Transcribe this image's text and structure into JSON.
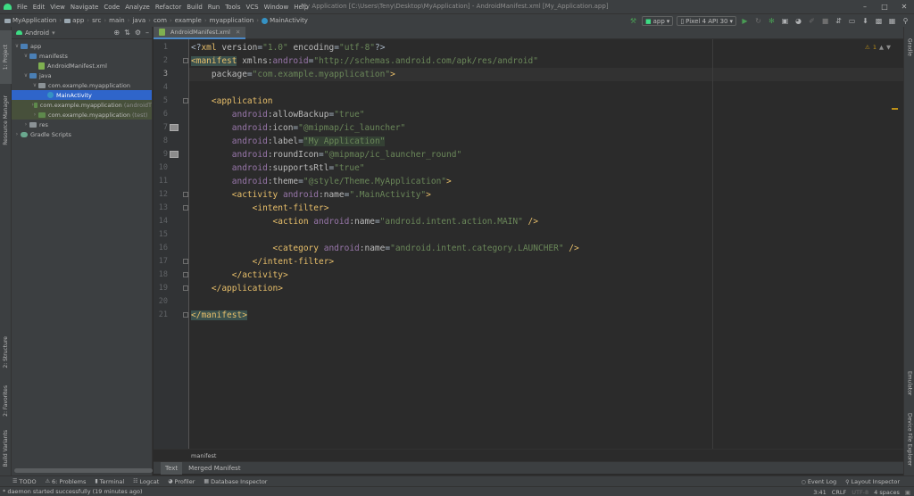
{
  "menubar": {
    "items": [
      "File",
      "Edit",
      "View",
      "Navigate",
      "Code",
      "Analyze",
      "Refactor",
      "Build",
      "Run",
      "Tools",
      "VCS",
      "Window",
      "Help"
    ],
    "window_title": "My Application [C:\\Users\\Teny\\Desktop\\MyApplication] - AndroidManifest.xml [My_Application.app]"
  },
  "navbar": {
    "breadcrumbs": [
      "MyApplication",
      "app",
      "src",
      "main",
      "java",
      "com",
      "example",
      "myapplication",
      "MainActivity"
    ],
    "run_config": "app",
    "device": "Pixel 4 API 30"
  },
  "left_tabs": [
    "1: Project",
    "Resource Manager",
    "2: Structure",
    "2: Favorites",
    "Build Variants"
  ],
  "right_tabs": [
    "Gradle",
    "Emulator",
    "Device File Explorer"
  ],
  "project": {
    "view_label": "Android",
    "tree": [
      {
        "label": "app",
        "suffix": "",
        "indent": 0,
        "arrow": "open",
        "icon": "folder-blue"
      },
      {
        "label": "manifests",
        "suffix": "",
        "indent": 1,
        "arrow": "open",
        "icon": "folder-blue"
      },
      {
        "label": "AndroidManifest.xml",
        "suffix": "",
        "indent": 2,
        "arrow": "",
        "icon": "xml"
      },
      {
        "label": "java",
        "suffix": "",
        "indent": 1,
        "arrow": "open",
        "icon": "folder-blue"
      },
      {
        "label": "com.example.myapplication",
        "suffix": "",
        "indent": 2,
        "arrow": "open",
        "icon": "folder-grey"
      },
      {
        "label": "MainActivity",
        "suffix": "",
        "indent": 3,
        "arrow": "",
        "icon": "class",
        "selected": true
      },
      {
        "label": "com.example.myapplication",
        "suffix": "(androidT",
        "indent": 2,
        "arrow": "closed",
        "icon": "folder-green",
        "green": true
      },
      {
        "label": "com.example.myapplication",
        "suffix": "(test)",
        "indent": 2,
        "arrow": "closed",
        "icon": "folder-green",
        "green": true
      },
      {
        "label": "res",
        "suffix": "",
        "indent": 1,
        "arrow": "closed",
        "icon": "folder-grey"
      },
      {
        "label": "Gradle Scripts",
        "suffix": "",
        "indent": 0,
        "arrow": "closed",
        "icon": "gradle"
      }
    ]
  },
  "editor": {
    "tab_label": "AndroidManifest.xml",
    "warning_count": "1",
    "breadcrumb": "manifest",
    "view_tabs": [
      "Text",
      "Merged Manifest"
    ],
    "lines": [
      [
        {
          "c": "p",
          "s": "<?"
        },
        {
          "c": "t",
          "s": "xml "
        },
        {
          "c": "a",
          "s": "version"
        },
        {
          "c": "p",
          "s": "="
        },
        {
          "c": "v",
          "s": "\"1.0\""
        },
        {
          "c": "p",
          "s": " "
        },
        {
          "c": "a",
          "s": "encoding"
        },
        {
          "c": "p",
          "s": "="
        },
        {
          "c": "v",
          "s": "\"utf-8\""
        },
        {
          "c": "p",
          "s": "?>"
        }
      ],
      [
        {
          "c": "t hl",
          "s": "<manifest"
        },
        {
          "c": "a",
          "s": " xmlns:"
        },
        {
          "c": "ns",
          "s": "android"
        },
        {
          "c": "p",
          "s": "="
        },
        {
          "c": "v",
          "s": "\"http://schemas.android.com/apk/res/android\""
        }
      ],
      [
        {
          "c": "a",
          "s": "    package"
        },
        {
          "c": "p",
          "s": "="
        },
        {
          "c": "v",
          "s": "\"com.example.myapplication\""
        },
        {
          "c": "t",
          "s": ">"
        }
      ],
      [],
      [
        {
          "c": "p",
          "s": "    "
        },
        {
          "c": "t",
          "s": "<application"
        }
      ],
      [
        {
          "c": "p",
          "s": "        "
        },
        {
          "c": "ns",
          "s": "android"
        },
        {
          "c": "a",
          "s": ":allowBackup"
        },
        {
          "c": "p",
          "s": "="
        },
        {
          "c": "v",
          "s": "\"true\""
        }
      ],
      [
        {
          "c": "p",
          "s": "        "
        },
        {
          "c": "ns",
          "s": "android"
        },
        {
          "c": "a",
          "s": ":icon"
        },
        {
          "c": "p",
          "s": "="
        },
        {
          "c": "v",
          "s": "\"@mipmap/ic_launcher\""
        }
      ],
      [
        {
          "c": "p",
          "s": "        "
        },
        {
          "c": "ns",
          "s": "android"
        },
        {
          "c": "a",
          "s": ":label"
        },
        {
          "c": "p",
          "s": "="
        },
        {
          "c": "v strhl",
          "s": "\"My Application\""
        }
      ],
      [
        {
          "c": "p",
          "s": "        "
        },
        {
          "c": "ns",
          "s": "android"
        },
        {
          "c": "a",
          "s": ":roundIcon"
        },
        {
          "c": "p",
          "s": "="
        },
        {
          "c": "v",
          "s": "\"@mipmap/ic_launcher_round\""
        }
      ],
      [
        {
          "c": "p",
          "s": "        "
        },
        {
          "c": "ns",
          "s": "android"
        },
        {
          "c": "a",
          "s": ":supportsRtl"
        },
        {
          "c": "p",
          "s": "="
        },
        {
          "c": "v",
          "s": "\"true\""
        }
      ],
      [
        {
          "c": "p",
          "s": "        "
        },
        {
          "c": "ns",
          "s": "android"
        },
        {
          "c": "a",
          "s": ":theme"
        },
        {
          "c": "p",
          "s": "="
        },
        {
          "c": "v",
          "s": "\"@style/Theme.MyApplication\""
        },
        {
          "c": "t",
          "s": ">"
        }
      ],
      [
        {
          "c": "p",
          "s": "        "
        },
        {
          "c": "t",
          "s": "<activity "
        },
        {
          "c": "ns",
          "s": "android"
        },
        {
          "c": "a",
          "s": ":name"
        },
        {
          "c": "p",
          "s": "="
        },
        {
          "c": "v",
          "s": "\".MainActivity\""
        },
        {
          "c": "t",
          "s": ">"
        }
      ],
      [
        {
          "c": "p",
          "s": "            "
        },
        {
          "c": "t",
          "s": "<intent-filter>"
        }
      ],
      [
        {
          "c": "p",
          "s": "                "
        },
        {
          "c": "t",
          "s": "<action "
        },
        {
          "c": "ns",
          "s": "android"
        },
        {
          "c": "a",
          "s": ":name"
        },
        {
          "c": "p",
          "s": "="
        },
        {
          "c": "v",
          "s": "\"android.intent.action.MAIN\""
        },
        {
          "c": "t",
          "s": " />"
        }
      ],
      [],
      [
        {
          "c": "p",
          "s": "                "
        },
        {
          "c": "t",
          "s": "<category "
        },
        {
          "c": "ns",
          "s": "android"
        },
        {
          "c": "a",
          "s": ":name"
        },
        {
          "c": "p",
          "s": "="
        },
        {
          "c": "v",
          "s": "\"android.intent.category.LAUNCHER\""
        },
        {
          "c": "t",
          "s": " />"
        }
      ],
      [
        {
          "c": "p",
          "s": "            "
        },
        {
          "c": "t",
          "s": "</intent-filter>"
        }
      ],
      [
        {
          "c": "p",
          "s": "        "
        },
        {
          "c": "t",
          "s": "</activity>"
        }
      ],
      [
        {
          "c": "p",
          "s": "    "
        },
        {
          "c": "t",
          "s": "</application>"
        }
      ],
      [],
      [
        {
          "c": "t hl",
          "s": "</manifest>"
        }
      ]
    ],
    "current_line": 3,
    "image_gutter_lines": [
      7,
      9
    ],
    "fold_lines": [
      2,
      5,
      12,
      13,
      17,
      18,
      19,
      21
    ]
  },
  "bottom_tools": {
    "left": [
      "TODO",
      "6: Problems",
      "Terminal",
      "Logcat",
      "Profiler",
      "Database Inspector"
    ],
    "right": [
      "Event Log",
      "Layout Inspector"
    ]
  },
  "status": {
    "message": "* daemon started successfully (19 minutes ago)",
    "position": "3:41",
    "line_sep": "CRLF",
    "encoding": "UTF-8",
    "indent": "4 spaces"
  }
}
